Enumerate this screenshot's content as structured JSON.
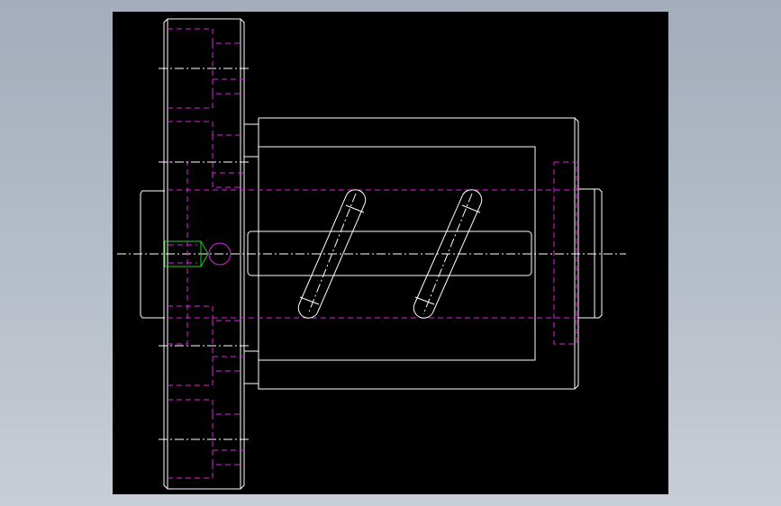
{
  "colors": {
    "background_outer": "#b3bcc8",
    "viewport": "#000000",
    "visible_edge": "#ffffff",
    "hidden_edge": "#e020e0",
    "thread": "#22cc22"
  },
  "drawing": {
    "view": "cad-2d-section",
    "line_types": [
      "visible",
      "hidden",
      "center"
    ]
  }
}
